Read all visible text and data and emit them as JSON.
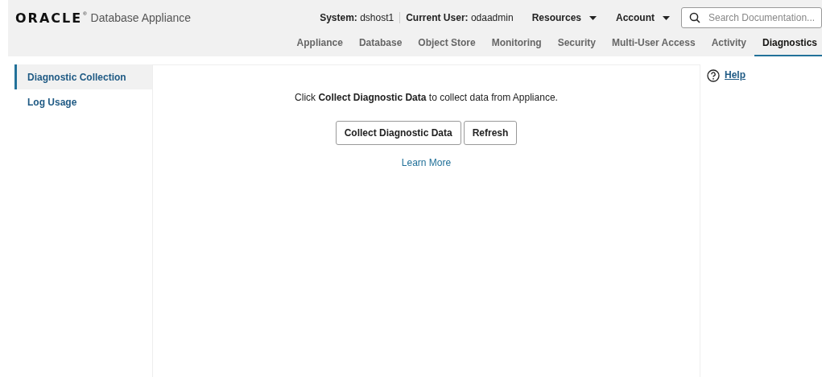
{
  "header": {
    "logo": "ORACLE",
    "logo_mark": "®",
    "product": "Database Appliance",
    "system_label": "System:",
    "system_value": "dshost1",
    "user_label": "Current User:",
    "user_value": "odaadmin",
    "menus": [
      "Resources",
      "Account"
    ],
    "search": {
      "placeholder": "Search Documentation..."
    }
  },
  "tabs": [
    {
      "label": "Appliance",
      "selected": false
    },
    {
      "label": "Database",
      "selected": false
    },
    {
      "label": "Object Store",
      "selected": false
    },
    {
      "label": "Monitoring",
      "selected": false
    },
    {
      "label": "Security",
      "selected": false
    },
    {
      "label": "Multi-User Access",
      "selected": false
    },
    {
      "label": "Activity",
      "selected": false
    },
    {
      "label": "Diagnostics",
      "selected": true
    }
  ],
  "sidebar": {
    "items": [
      {
        "label": "Diagnostic Collection",
        "selected": true
      },
      {
        "label": "Log Usage",
        "selected": false
      }
    ]
  },
  "content": {
    "message": "Click **Collect Diagnostic Data** to collect data from Appliance.",
    "buttons": [
      "Collect Diagnostic Data",
      "Refresh"
    ],
    "link": "Learn More"
  },
  "help": {
    "label": "Help"
  }
}
